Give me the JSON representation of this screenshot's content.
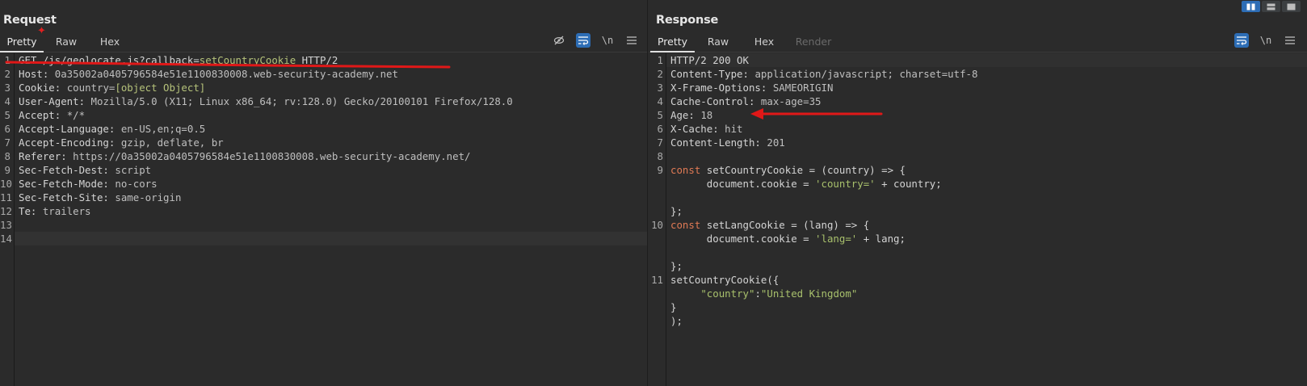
{
  "layout_buttons": [
    "split-horizontal-icon",
    "split-vertical-icon",
    "single-pane-icon"
  ],
  "request": {
    "title": "Request",
    "tabs": [
      {
        "label": "Pretty"
      },
      {
        "label": "Raw"
      },
      {
        "label": "Hex"
      }
    ],
    "active_tab": "Pretty",
    "tool_icons": [
      "hide-icon",
      "wrap-icon",
      "newline-icon",
      "menu-icon"
    ],
    "newline_label": "\\n",
    "lines": [
      {
        "n": "1",
        "parts": [
          {
            "t": "GET /js/geolocate.js?callback=",
            "c": "k"
          },
          {
            "t": "setCountryCookie",
            "c": "g"
          },
          {
            "t": " HTTP/2",
            "c": "k"
          }
        ]
      },
      {
        "n": "2",
        "parts": [
          {
            "t": "Host: ",
            "c": "k"
          },
          {
            "t": "0a35002a0405796584e51e1100830008.web-security-academy.net",
            "c": "v"
          }
        ]
      },
      {
        "n": "3",
        "parts": [
          {
            "t": "Cookie: ",
            "c": "k"
          },
          {
            "t": "country=",
            "c": "v"
          },
          {
            "t": "[object Object]",
            "c": "g"
          }
        ]
      },
      {
        "n": "4",
        "parts": [
          {
            "t": "User-Agent: ",
            "c": "k"
          },
          {
            "t": "Mozilla/5.0 (X11; Linux x86_64; rv:128.0) Gecko/20100101 Firefox/128.0",
            "c": "v"
          }
        ]
      },
      {
        "n": "5",
        "parts": [
          {
            "t": "Accept: ",
            "c": "k"
          },
          {
            "t": "*/*",
            "c": "v"
          }
        ]
      },
      {
        "n": "6",
        "parts": [
          {
            "t": "Accept-Language: ",
            "c": "k"
          },
          {
            "t": "en-US,en;q=0.5",
            "c": "v"
          }
        ]
      },
      {
        "n": "7",
        "parts": [
          {
            "t": "Accept-Encoding: ",
            "c": "k"
          },
          {
            "t": "gzip, deflate, br",
            "c": "v"
          }
        ]
      },
      {
        "n": "8",
        "parts": [
          {
            "t": "Referer: ",
            "c": "k"
          },
          {
            "t": "https://0a35002a0405796584e51e1100830008.web-security-academy.net/",
            "c": "v"
          }
        ]
      },
      {
        "n": "9",
        "parts": [
          {
            "t": "Sec-Fetch-Dest: ",
            "c": "k"
          },
          {
            "t": "script",
            "c": "v"
          }
        ]
      },
      {
        "n": "10",
        "parts": [
          {
            "t": "Sec-Fetch-Mode: ",
            "c": "k"
          },
          {
            "t": "no-cors",
            "c": "v"
          }
        ]
      },
      {
        "n": "11",
        "parts": [
          {
            "t": "Sec-Fetch-Site: ",
            "c": "k"
          },
          {
            "t": "same-origin",
            "c": "v"
          }
        ]
      },
      {
        "n": "12",
        "parts": [
          {
            "t": "Te: ",
            "c": "k"
          },
          {
            "t": "trailers",
            "c": "v"
          }
        ]
      },
      {
        "n": "13",
        "parts": []
      },
      {
        "n": "14",
        "parts": []
      }
    ]
  },
  "response": {
    "title": "Response",
    "tabs": [
      {
        "label": "Pretty"
      },
      {
        "label": "Raw"
      },
      {
        "label": "Hex"
      },
      {
        "label": "Render"
      }
    ],
    "active_tab": "Pretty",
    "tool_icons": [
      "wrap-icon",
      "newline-icon",
      "menu-icon"
    ],
    "newline_label": "\\n",
    "lines": [
      {
        "n": "1",
        "parts": [
          {
            "t": "HTTP/2 200 OK",
            "c": "k"
          }
        ]
      },
      {
        "n": "2",
        "parts": [
          {
            "t": "Content-Type: ",
            "c": "k"
          },
          {
            "t": "application/javascript; charset=utf-8",
            "c": "v"
          }
        ]
      },
      {
        "n": "3",
        "parts": [
          {
            "t": "X-Frame-Options: ",
            "c": "k"
          },
          {
            "t": "SAMEORIGIN",
            "c": "v"
          }
        ]
      },
      {
        "n": "4",
        "parts": [
          {
            "t": "Cache-Control: ",
            "c": "k"
          },
          {
            "t": "max-age=35",
            "c": "v"
          }
        ]
      },
      {
        "n": "5",
        "parts": [
          {
            "t": "Age: ",
            "c": "k"
          },
          {
            "t": "18",
            "c": "v"
          }
        ]
      },
      {
        "n": "6",
        "parts": [
          {
            "t": "X-Cache: ",
            "c": "k"
          },
          {
            "t": "hit",
            "c": "v"
          }
        ]
      },
      {
        "n": "7",
        "parts": [
          {
            "t": "Content-Length: ",
            "c": "k"
          },
          {
            "t": "201",
            "c": "v"
          }
        ]
      },
      {
        "n": "8",
        "parts": []
      },
      {
        "n": "9",
        "parts": [
          {
            "t": "const",
            "c": "kw"
          },
          {
            "t": " setCountryCookie = (country) => {",
            "c": "k"
          }
        ]
      },
      {
        "n": "",
        "parts": [
          {
            "t": "      document.cookie = ",
            "c": "k"
          },
          {
            "t": "'country='",
            "c": "str"
          },
          {
            "t": " + country;",
            "c": "k"
          }
        ]
      },
      {
        "n": "",
        "parts": []
      },
      {
        "n": "",
        "parts": [
          {
            "t": "};",
            "c": "k"
          }
        ]
      },
      {
        "n": "10",
        "parts": [
          {
            "t": "const",
            "c": "kw"
          },
          {
            "t": " setLangCookie = (lang) => {",
            "c": "k"
          }
        ]
      },
      {
        "n": "",
        "parts": [
          {
            "t": "      document.cookie = ",
            "c": "k"
          },
          {
            "t": "'lang='",
            "c": "str"
          },
          {
            "t": " + lang;",
            "c": "k"
          }
        ]
      },
      {
        "n": "",
        "parts": []
      },
      {
        "n": "",
        "parts": [
          {
            "t": "};",
            "c": "k"
          }
        ]
      },
      {
        "n": "11",
        "parts": [
          {
            "t": "setCountryCookie({",
            "c": "k"
          }
        ]
      },
      {
        "n": "",
        "parts": [
          {
            "t": "     ",
            "c": "k"
          },
          {
            "t": "\"country\"",
            "c": "str"
          },
          {
            "t": ":",
            "c": "k"
          },
          {
            "t": "\"United Kingdom\"",
            "c": "str"
          }
        ]
      },
      {
        "n": "",
        "parts": [
          {
            "t": "}",
            "c": "k"
          }
        ]
      },
      {
        "n": "",
        "parts": [
          {
            "t": ");",
            "c": "k"
          }
        ]
      }
    ]
  },
  "annotation_color": "#e01818"
}
